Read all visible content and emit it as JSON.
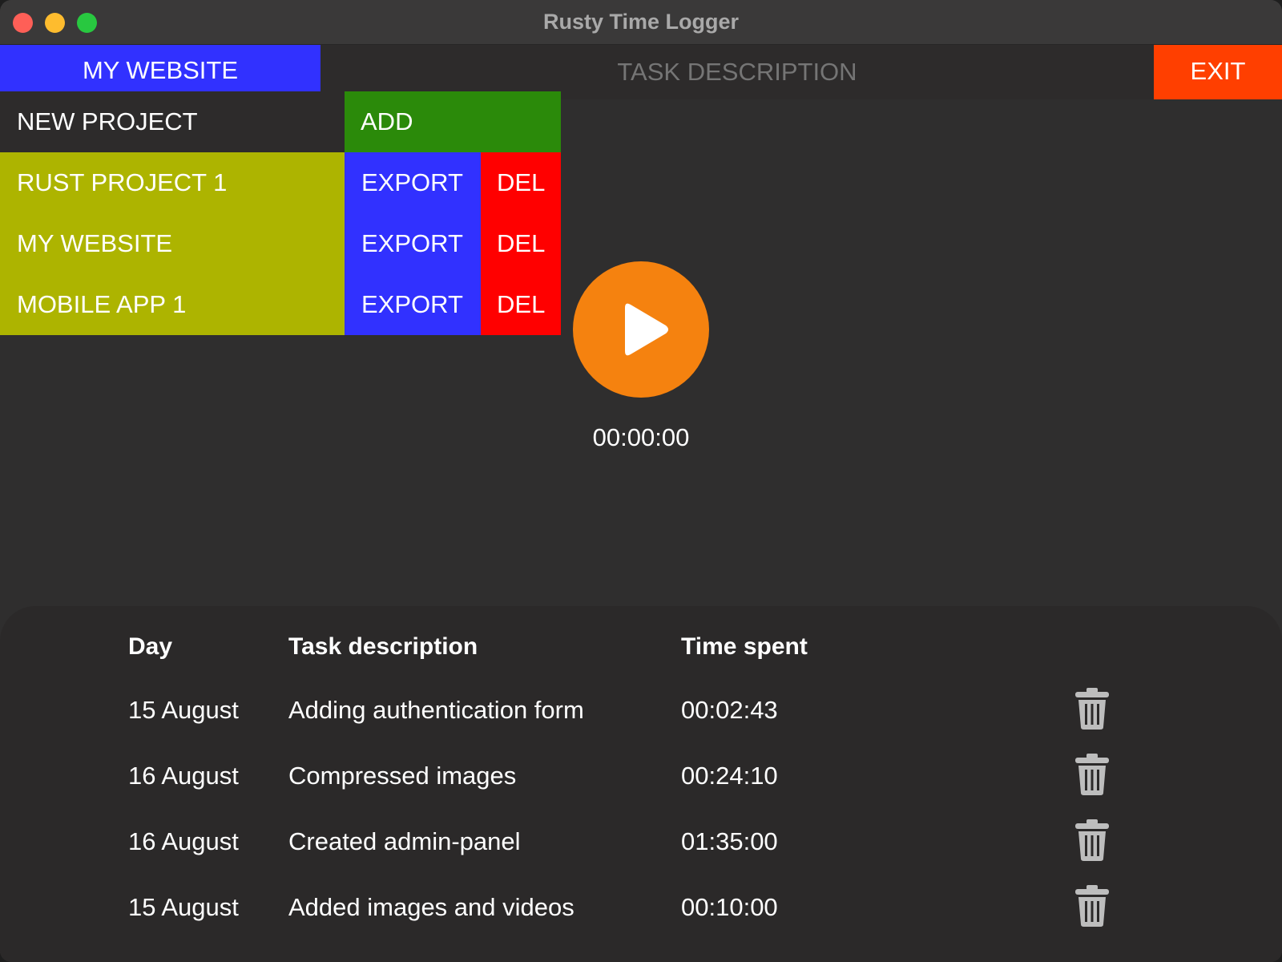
{
  "window": {
    "title": "Rusty Time Logger"
  },
  "header": {
    "current_project": "MY WEBSITE",
    "task_description_placeholder": "TASK DESCRIPTION",
    "exit_label": "EXIT"
  },
  "projects": {
    "new_project_placeholder": "NEW PROJECT",
    "add_label": "ADD",
    "items": [
      {
        "name": "RUST PROJECT 1",
        "export_label": "EXPORT",
        "del_label": "DEL"
      },
      {
        "name": "MY WEBSITE",
        "export_label": "EXPORT",
        "del_label": "DEL"
      },
      {
        "name": "MOBILE APP 1",
        "export_label": "EXPORT",
        "del_label": "DEL"
      }
    ]
  },
  "timer": {
    "value": "00:00:00",
    "button_icon": "play-icon"
  },
  "log": {
    "headers": {
      "day": "Day",
      "description": "Task description",
      "time": "Time spent"
    },
    "rows": [
      {
        "day": "15 August",
        "description": "Adding authentication form",
        "time": "00:02:43",
        "icon": "trash-icon"
      },
      {
        "day": "16 August",
        "description": "Compressed images",
        "time": "00:24:10",
        "icon": "trash-icon"
      },
      {
        "day": "16 August",
        "description": "Created admin-panel",
        "time": "01:35:00",
        "icon": "trash-icon"
      },
      {
        "day": "15 August",
        "description": "Added images and videos",
        "time": "00:10:00",
        "icon": "trash-icon"
      }
    ]
  },
  "colors": {
    "current_project_bg": "#3131ff",
    "exit_bg": "#ff3f00",
    "add_bg": "#2b8a0a",
    "project_bg": "#adb400",
    "export_bg": "#3131ff",
    "del_bg": "#ff0000",
    "play_bg": "#f5820f"
  }
}
